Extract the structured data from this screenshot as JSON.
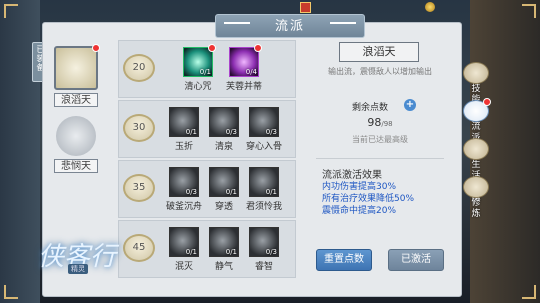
{
  "title": "流派",
  "side_tab": "已装备",
  "hud": {
    "coin_label": "",
    "box_label": ""
  },
  "schools": [
    {
      "name": "浪滔天",
      "selected": true,
      "has_alert": true
    },
    {
      "name": "悲悯天",
      "selected": false,
      "has_alert": false
    }
  ],
  "tree": [
    {
      "level": "20",
      "skills": [
        {
          "name": "清心咒",
          "count": "0/1",
          "style": "active-1",
          "alert": true
        },
        {
          "name": "芙蓉并蒂",
          "count": "0/4",
          "style": "active-2",
          "alert": true
        }
      ]
    },
    {
      "level": "30",
      "skills": [
        {
          "name": "玉折",
          "count": "0/1",
          "style": "",
          "alert": false
        },
        {
          "name": "清泉",
          "count": "0/3",
          "style": "",
          "alert": false
        },
        {
          "name": "穿心入骨",
          "count": "0/3",
          "style": "",
          "alert": false
        }
      ]
    },
    {
      "level": "35",
      "skills": [
        {
          "name": "破釜沉舟",
          "count": "0/3",
          "style": "",
          "alert": false
        },
        {
          "name": "穿透",
          "count": "0/1",
          "style": "",
          "alert": false
        },
        {
          "name": "君须怜我",
          "count": "0/1",
          "style": "",
          "alert": false
        }
      ]
    },
    {
      "level": "45",
      "skills": [
        {
          "name": "泯灭",
          "count": "0/1",
          "style": "",
          "alert": false
        },
        {
          "name": "静气",
          "count": "0/1",
          "style": "",
          "alert": false
        },
        {
          "name": "睿智",
          "count": "0/3",
          "style": "",
          "alert": false
        }
      ]
    }
  ],
  "detail": {
    "school_name": "浪滔天",
    "description": "输出流，震慑敌人以增加输出",
    "points_label": "剩余点数",
    "points_value": "98",
    "points_max": "/98",
    "points_note": "当前已达最高级",
    "effects_title": "流派激活效果",
    "effects": [
      "内功伤害提高30%",
      "所有治疗效果降低50%",
      "震慑命中提高20%"
    ],
    "reset_button": "重置点数",
    "activated_button": "已激活"
  },
  "right_nav": [
    {
      "label": "技能",
      "active": false,
      "alert": false
    },
    {
      "label": "流派",
      "active": true,
      "alert": true
    },
    {
      "label": "生活技能",
      "active": false,
      "alert": false
    },
    {
      "label": "修炼",
      "active": false,
      "alert": false
    }
  ],
  "logo": {
    "title": "侠客行",
    "subtitle": "精灵"
  },
  "colors": {
    "accent_blue": "#3e74b3",
    "effect_text": "#1f57c3",
    "alert_red": "#e33333"
  }
}
